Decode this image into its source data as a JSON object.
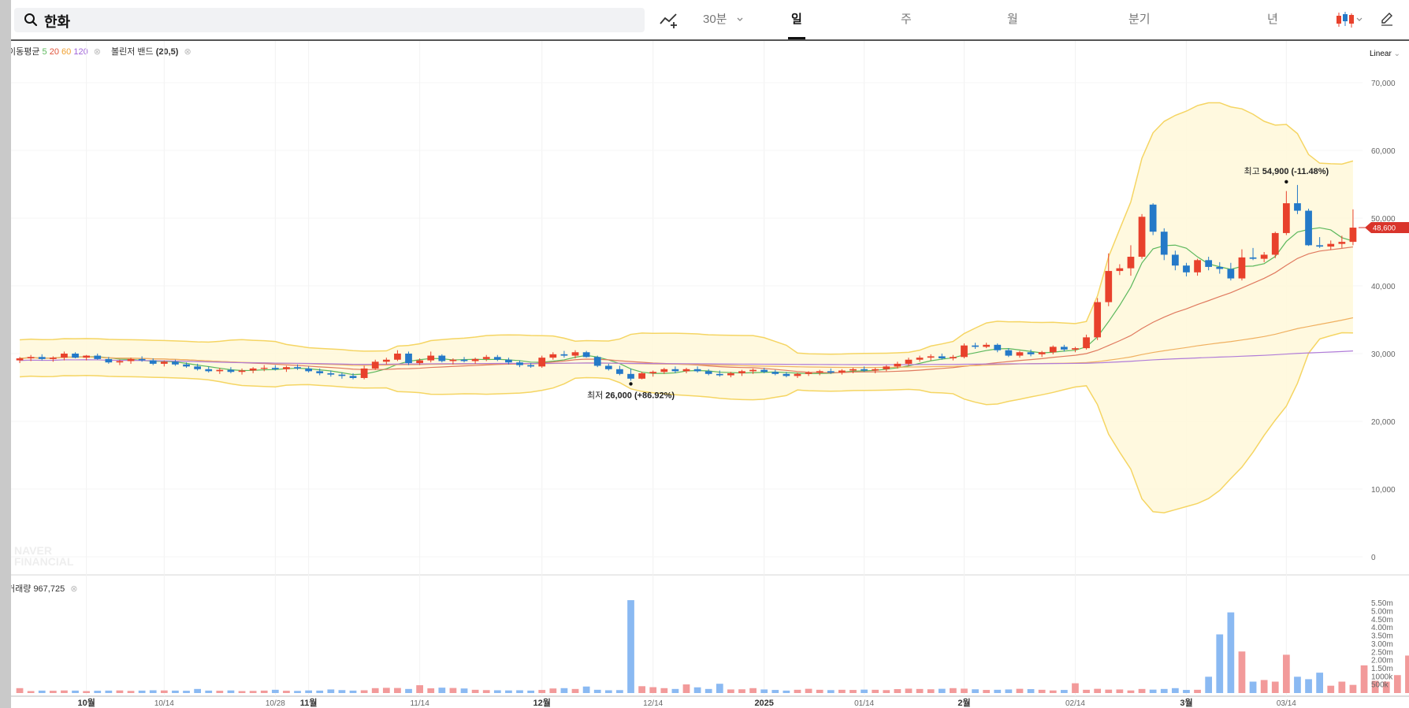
{
  "search": {
    "query": "한화"
  },
  "toolbar": {
    "interval": "30분",
    "tabs": [
      "일",
      "주",
      "월",
      "분기",
      "년"
    ],
    "active_tab": "일"
  },
  "legend": {
    "ma_label": "이동평균",
    "ma_periods": [
      "5",
      "20",
      "60",
      "120"
    ],
    "bb_label": "볼린저 밴드",
    "bb_params": "(20,5)",
    "volume_label": "거래량",
    "volume_value": "967,725"
  },
  "scale_label": "Linear",
  "watermark": "NAVER FINANCIAL",
  "colors": {
    "up": "#e8412c",
    "down": "#2479c8",
    "ma5": "#5cb85c",
    "ma20": "#e07a5f",
    "ma60": "#f0b060",
    "ma120": "#b07cd8",
    "band_line": "#f5d563",
    "band_fill": "#fff8dc",
    "vol_up": "#f29a9a",
    "vol_down": "#8ab9f2",
    "last_price": "#d9342b"
  },
  "chart_data": [
    {
      "type": "candlestick",
      "title": "",
      "y_ticks": [
        "0",
        "10,000",
        "20,000",
        "30,000",
        "40,000",
        "50,000",
        "60,000",
        "70,000"
      ],
      "ylim": [
        0,
        75000
      ],
      "x_labels": [
        {
          "label": "10월",
          "index": 6,
          "strong": true
        },
        {
          "label": "10/14",
          "index": 13,
          "strong": false
        },
        {
          "label": "10/28",
          "index": 23,
          "strong": false
        },
        {
          "label": "11월",
          "index": 26,
          "strong": true
        },
        {
          "label": "11/14",
          "index": 36,
          "strong": false
        },
        {
          "label": "12월",
          "index": 47,
          "strong": true
        },
        {
          "label": "12/14",
          "index": 57,
          "strong": false
        },
        {
          "label": "2025",
          "index": 67,
          "strong": true
        },
        {
          "label": "01/14",
          "index": 76,
          "strong": false
        },
        {
          "label": "2월",
          "index": 85,
          "strong": true
        },
        {
          "label": "02/14",
          "index": 95,
          "strong": false
        },
        {
          "label": "3월",
          "index": 105,
          "strong": true
        },
        {
          "label": "03/14",
          "index": 114,
          "strong": false
        }
      ],
      "ohlc": [
        [
          29000,
          29500,
          28600,
          29300
        ],
        [
          29300,
          29800,
          28900,
          29500
        ],
        [
          29500,
          29900,
          29000,
          29200
        ],
        [
          29200,
          29600,
          28800,
          29400
        ],
        [
          29400,
          30300,
          29000,
          30000
        ],
        [
          30000,
          30200,
          29300,
          29400
        ],
        [
          29400,
          29800,
          29000,
          29700
        ],
        [
          29700,
          30000,
          29100,
          29200
        ],
        [
          29200,
          29500,
          28500,
          28700
        ],
        [
          28700,
          29100,
          28300,
          28900
        ],
        [
          28900,
          29400,
          28500,
          29200
        ],
        [
          29200,
          29600,
          28800,
          29000
        ],
        [
          29000,
          29300,
          28300,
          28500
        ],
        [
          28500,
          29000,
          28100,
          28800
        ],
        [
          28800,
          29100,
          28200,
          28400
        ],
        [
          28400,
          28700,
          27900,
          28100
        ],
        [
          28100,
          28500,
          27500,
          27700
        ],
        [
          27700,
          28100,
          27200,
          27400
        ],
        [
          27400,
          27900,
          27000,
          27600
        ],
        [
          27600,
          28000,
          27100,
          27300
        ],
        [
          27300,
          27800,
          26900,
          27500
        ],
        [
          27500,
          28000,
          27100,
          27800
        ],
        [
          27800,
          28300,
          27400,
          27900
        ],
        [
          27900,
          28300,
          27500,
          27700
        ],
        [
          27700,
          28200,
          27300,
          28000
        ],
        [
          28000,
          28400,
          27600,
          27800
        ],
        [
          27800,
          28100,
          27200,
          27400
        ],
        [
          27400,
          27800,
          26800,
          27100
        ],
        [
          27100,
          27500,
          26600,
          26900
        ],
        [
          26900,
          27200,
          26300,
          26700
        ],
        [
          26700,
          27100,
          26200,
          26400
        ],
        [
          26400,
          28200,
          26200,
          27800
        ],
        [
          27800,
          29100,
          27600,
          28800
        ],
        [
          28800,
          29400,
          28400,
          29100
        ],
        [
          29100,
          30500,
          28900,
          30000
        ],
        [
          30000,
          30300,
          28300,
          28600
        ],
        [
          28600,
          29300,
          28300,
          29000
        ],
        [
          29000,
          30300,
          28700,
          29700
        ],
        [
          29700,
          29900,
          28700,
          28900
        ],
        [
          28900,
          29300,
          28400,
          29100
        ],
        [
          29100,
          29500,
          28700,
          28900
        ],
        [
          28900,
          29400,
          28500,
          29200
        ],
        [
          29200,
          29800,
          28900,
          29500
        ],
        [
          29500,
          29800,
          28900,
          29100
        ],
        [
          29100,
          29400,
          28400,
          28700
        ],
        [
          28700,
          29000,
          28000,
          28300
        ],
        [
          28300,
          28600,
          27900,
          28100
        ],
        [
          28100,
          29700,
          27900,
          29400
        ],
        [
          29400,
          30200,
          29100,
          29900
        ],
        [
          29900,
          30400,
          29400,
          29700
        ],
        [
          29700,
          30500,
          29300,
          30200
        ],
        [
          30200,
          30400,
          29400,
          29500
        ],
        [
          29500,
          29700,
          28000,
          28200
        ],
        [
          28200,
          28500,
          27500,
          27700
        ],
        [
          27700,
          28200,
          26800,
          27000
        ],
        [
          27000,
          27800,
          26000,
          26300
        ],
        [
          26300,
          27300,
          26200,
          27100
        ],
        [
          27100,
          27500,
          26600,
          27300
        ],
        [
          27300,
          27900,
          27000,
          27700
        ],
        [
          27700,
          28100,
          27100,
          27400
        ],
        [
          27400,
          27900,
          27100,
          27700
        ],
        [
          27700,
          28100,
          27200,
          27400
        ],
        [
          27400,
          27700,
          26800,
          27000
        ],
        [
          27000,
          27500,
          26600,
          26800
        ],
        [
          26800,
          27300,
          26500,
          27100
        ],
        [
          27100,
          27600,
          26700,
          27400
        ],
        [
          27400,
          27800,
          27000,
          27600
        ],
        [
          27600,
          27900,
          27100,
          27300
        ],
        [
          27300,
          27600,
          26800,
          27000
        ],
        [
          27000,
          27300,
          26500,
          26700
        ],
        [
          26700,
          27200,
          26400,
          27000
        ],
        [
          27000,
          27400,
          26700,
          27200
        ],
        [
          27200,
          27600,
          26800,
          27400
        ],
        [
          27400,
          27800,
          27000,
          27200
        ],
        [
          27200,
          27700,
          26900,
          27500
        ],
        [
          27500,
          27900,
          27100,
          27700
        ],
        [
          27700,
          28100,
          27300,
          27500
        ],
        [
          27500,
          27900,
          27100,
          27700
        ],
        [
          27700,
          28300,
          27400,
          28100
        ],
        [
          28100,
          28800,
          27800,
          28500
        ],
        [
          28500,
          29400,
          28200,
          29100
        ],
        [
          29100,
          29700,
          28800,
          29400
        ],
        [
          29400,
          29900,
          29000,
          29600
        ],
        [
          29600,
          30000,
          29100,
          29300
        ],
        [
          29300,
          29800,
          29000,
          29500
        ],
        [
          29500,
          31500,
          29300,
          31200
        ],
        [
          31200,
          31600,
          30700,
          31000
        ],
        [
          31000,
          31600,
          30800,
          31300
        ],
        [
          31300,
          31500,
          30200,
          30500
        ],
        [
          30500,
          30800,
          29500,
          29700
        ],
        [
          29700,
          30400,
          29400,
          30200
        ],
        [
          30200,
          30600,
          29600,
          29900
        ],
        [
          29900,
          30400,
          29500,
          30200
        ],
        [
          30200,
          31200,
          29900,
          31000
        ],
        [
          31000,
          31300,
          30300,
          30600
        ],
        [
          30600,
          31000,
          30200,
          30800
        ],
        [
          30800,
          32800,
          30600,
          32400
        ],
        [
          32400,
          38200,
          32000,
          37600
        ],
        [
          37600,
          44800,
          37000,
          42200
        ],
        [
          42200,
          43200,
          41600,
          42600
        ],
        [
          42600,
          46000,
          41500,
          44300
        ],
        [
          44300,
          50600,
          44000,
          50200
        ],
        [
          52000,
          52200,
          47500,
          48000
        ],
        [
          48000,
          48500,
          43800,
          44600
        ],
        [
          44600,
          45200,
          42300,
          43000
        ],
        [
          43000,
          43400,
          41400,
          42000
        ],
        [
          42000,
          44000,
          41500,
          43800
        ],
        [
          43800,
          44300,
          42300,
          42800
        ],
        [
          42800,
          43500,
          41800,
          42500
        ],
        [
          42500,
          43400,
          40800,
          41100
        ],
        [
          41100,
          45400,
          40800,
          44200
        ],
        [
          44200,
          45600,
          43800,
          44000
        ],
        [
          44000,
          45000,
          43500,
          44600
        ],
        [
          44600,
          48000,
          44100,
          47800
        ],
        [
          47800,
          54000,
          47500,
          52200
        ],
        [
          52200,
          54900,
          50600,
          51100
        ],
        [
          51100,
          51400,
          45900,
          46000
        ],
        [
          46000,
          47200,
          45600,
          45800
        ],
        [
          45800,
          46700,
          45300,
          46200
        ],
        [
          46200,
          47400,
          45600,
          46500
        ],
        [
          46500,
          51300,
          46000,
          48600
        ]
      ],
      "annotations": [
        {
          "label": "최고",
          "value": "54,900 (-11.48%)",
          "index": 114,
          "price": 54900
        },
        {
          "label": "최저",
          "value": "26,000 (+86.92%)",
          "index": 55,
          "price": 26000
        }
      ],
      "last_price": 48600,
      "last_price_label": "48,600",
      "series": [
        {
          "name": "5",
          "role": "ma5"
        },
        {
          "name": "20",
          "role": "ma20"
        },
        {
          "name": "60",
          "role": "ma60"
        },
        {
          "name": "120",
          "role": "ma120"
        }
      ]
    },
    {
      "type": "bar",
      "title": "",
      "y_ticks": [
        "500k",
        "1000k",
        "1.50m",
        "2.00m",
        "2.50m",
        "3.00m",
        "3.50m",
        "4.00m",
        "4.50m",
        "5.00m",
        "5.50m"
      ],
      "ylim": [
        0,
        5800000
      ],
      "volume": [
        300000,
        120000,
        150000,
        140000,
        160000,
        150000,
        120000,
        140000,
        150000,
        160000,
        130000,
        150000,
        170000,
        160000,
        150000,
        140000,
        250000,
        150000,
        140000,
        160000,
        120000,
        130000,
        150000,
        200000,
        140000,
        130000,
        160000,
        150000,
        220000,
        180000,
        150000,
        170000,
        300000,
        320000,
        310000,
        250000,
        480000,
        290000,
        330000,
        310000,
        280000,
        200000,
        180000,
        170000,
        160000,
        170000,
        150000,
        190000,
        280000,
        300000,
        250000,
        400000,
        200000,
        170000,
        180000,
        5700000,
        420000,
        360000,
        300000,
        250000,
        530000,
        350000,
        250000,
        570000,
        220000,
        230000,
        300000,
        220000,
        190000,
        150000,
        200000,
        260000,
        200000,
        180000,
        200000,
        190000,
        210000,
        200000,
        180000,
        240000,
        270000,
        250000,
        230000,
        260000,
        300000,
        270000,
        230000,
        190000,
        200000,
        220000,
        260000,
        240000,
        200000,
        160000,
        190000,
        600000,
        200000,
        260000,
        210000,
        220000,
        160000,
        250000,
        210000,
        250000,
        300000,
        190000,
        200000,
        1000000,
        3600000,
        4950000,
        2550000,
        700000,
        800000,
        700000,
        2350000,
        1000000,
        850000,
        1250000,
        450000,
        700000,
        500000,
        1700000,
        750000,
        700000,
        1100000,
        2300000,
        2050000,
        2800000,
        1450000,
        1000000,
        600000,
        1200000
      ]
    }
  ]
}
